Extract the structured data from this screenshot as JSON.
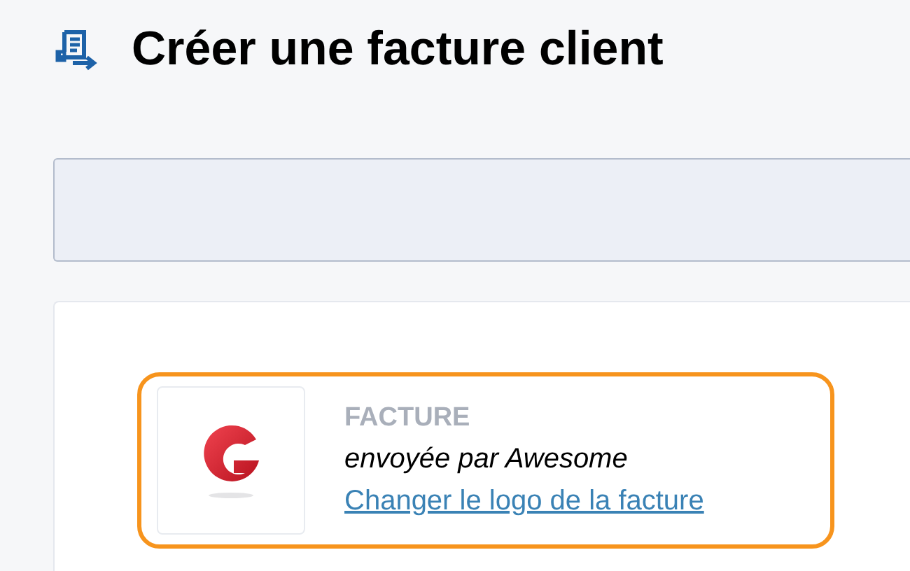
{
  "page": {
    "title": "Créer une facture client"
  },
  "invoice_header": {
    "label": "FACTURE",
    "sender": "envoyée par Awesome",
    "change_logo_link": "Changer le logo de la facture",
    "highlighted": true
  }
}
